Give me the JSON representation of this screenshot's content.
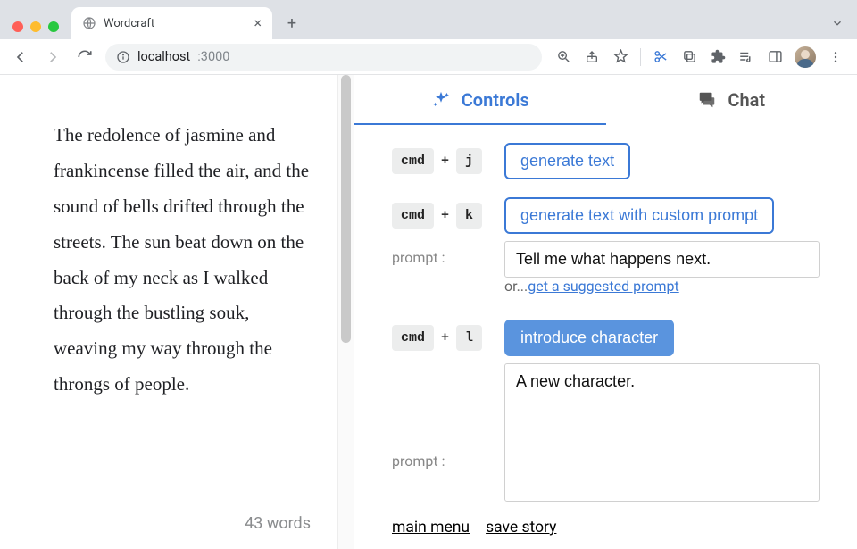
{
  "browser": {
    "tab_title": "Wordcraft",
    "url_host": "localhost",
    "url_port": ":3000"
  },
  "tabs": {
    "controls": "Controls",
    "chat": "Chat"
  },
  "story": {
    "text": " The redolence of jasmine and frankincense filled the air, and the sound of bells drifted through the streets. The sun beat down on the back of my neck as I walked through the bustling souk, weaving my way through the throngs of people.",
    "wordcount": "43 words"
  },
  "controls": {
    "row1": {
      "mod": "cmd",
      "plus": "+",
      "key": "j",
      "button": "generate text"
    },
    "row2": {
      "mod": "cmd",
      "plus": "+",
      "key": "k",
      "button": "generate text with custom prompt",
      "prompt_label": "prompt :",
      "prompt_value": "Tell me what happens next.",
      "or_prefix": "or...",
      "suggest_link": "get a suggested prompt"
    },
    "row3": {
      "mod": "cmd",
      "plus": "+",
      "key": "l",
      "button": "introduce character",
      "prompt_label": "prompt :",
      "prompt_value": "A new character."
    }
  },
  "footer": {
    "main_menu": "main menu",
    "save_story": "save story"
  }
}
